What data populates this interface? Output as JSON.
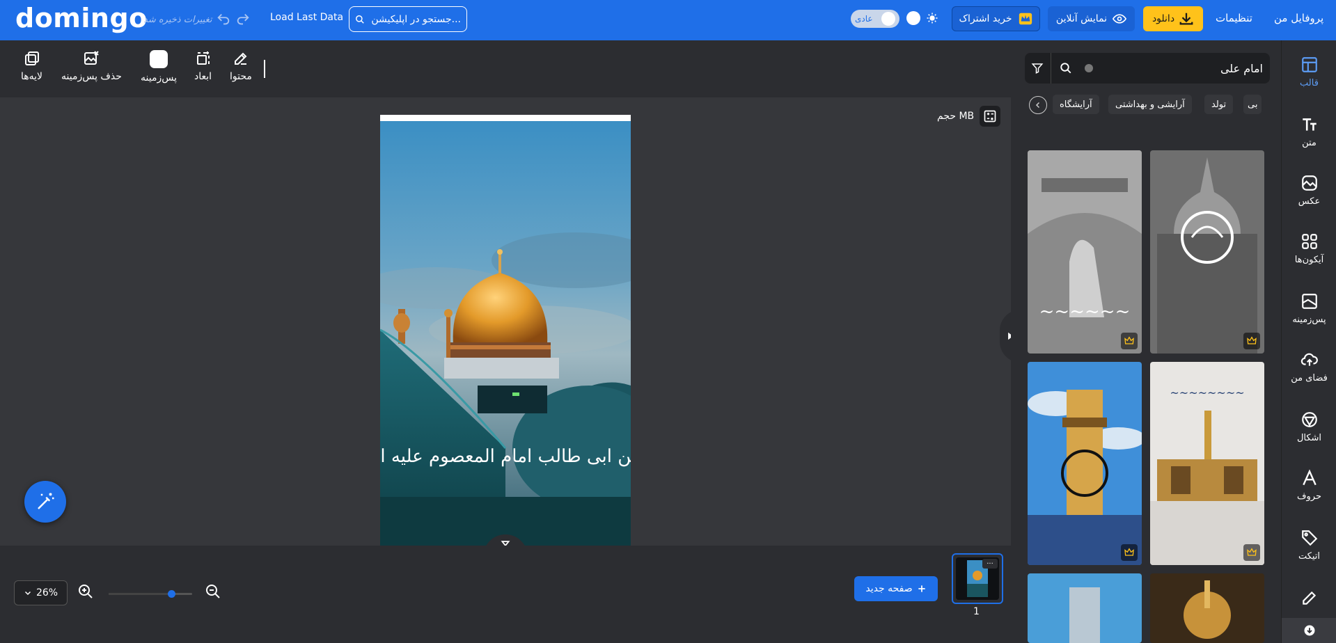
{
  "topbar": {
    "logo": "domingo",
    "unsaved_label": "تغییرات ذخیره شد",
    "load_last": "Load Last Data",
    "search_placeholder": "جستجو در اپلیکیشن...",
    "mode_label": "عادی",
    "subscribe_label": "خرید اشتراک",
    "live_label": "نمایش آنلاین",
    "download_label": "دانلود",
    "settings_label": "تنظیمات",
    "profile_label": "پروفایل من"
  },
  "toolbar": {
    "layers": "لایه‌ها",
    "remove_bg": "حذف پس‌زمینه",
    "background": "پس‌زمینه",
    "dimensions": "ابعاد",
    "content": "محتوا"
  },
  "canvas": {
    "size_label": "حجم MB",
    "calligraphy": "علی بن ابی طالب امام المعصوم علیه السلام"
  },
  "bottombar": {
    "zoom_value": "26%",
    "zoom_level": 0.75,
    "new_page": "صفحه جدید",
    "page_number": "1",
    "thumb_menu": "..."
  },
  "rpanel": {
    "search_value": "امام علی",
    "chips": [
      "آرایشگاه",
      "آرایشی و بهداشتی",
      "تولد",
      "بی"
    ]
  },
  "fnav": {
    "items": [
      {
        "label": "قالب",
        "icon": "template-icon"
      },
      {
        "label": "متن",
        "icon": "text-icon"
      },
      {
        "label": "عکس",
        "icon": "image-icon"
      },
      {
        "label": "آیکون‌ها",
        "icon": "grid-icon"
      },
      {
        "label": "پس‌زمینه",
        "icon": "background-icon"
      },
      {
        "label": "فضای من",
        "icon": "cloud-upload-icon"
      },
      {
        "label": "اشکال",
        "icon": "shapes-icon"
      },
      {
        "label": "حروف",
        "icon": "letter-icon"
      },
      {
        "label": "اتیکت",
        "icon": "tag-icon"
      }
    ]
  },
  "colors": {
    "accent": "#1f6fe8",
    "download": "#ffc21a",
    "panel": "#2c2d31",
    "canvas_bg": "#36373b"
  }
}
